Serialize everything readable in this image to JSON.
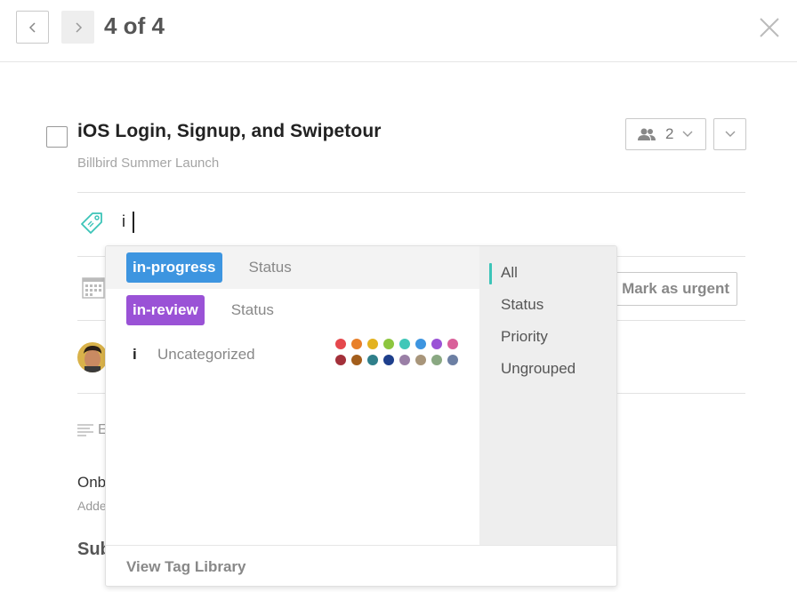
{
  "nav": {
    "prev_icon": "chevron-left-icon",
    "next_icon": "chevron-right-icon",
    "counter": "4 of 4",
    "close_icon": "close-icon"
  },
  "task": {
    "title": "iOS Login, Signup, and Swipetour",
    "project": "Billbird Summer Launch",
    "members_count": "2"
  },
  "tag_field": {
    "value": "i"
  },
  "actions": {
    "urgent_label": "Mark as urgent"
  },
  "background": {
    "description_fragment": "E",
    "onb": "Onb",
    "adde": "Adde",
    "sub": "Sub"
  },
  "dropdown": {
    "suggestions": [
      {
        "tag": "in-progress",
        "group": "Status",
        "color": "#3d95e0"
      },
      {
        "tag": "in-review",
        "group": "Status",
        "color": "#9a52d6"
      }
    ],
    "new_tag": {
      "tag": "i",
      "group": "Uncategorized"
    },
    "swatches": [
      "#e5484d",
      "#e8802a",
      "#e3b21f",
      "#8dc63f",
      "#40c7b8",
      "#3d95e0",
      "#9a52d6",
      "#d9609a",
      "#a3303a",
      "#a35e1c",
      "#2f7f8a",
      "#1e3f8c",
      "#9a7fa6",
      "#a8957a",
      "#8aa882",
      "#6c7fa3"
    ],
    "filters": [
      "All",
      "Status",
      "Priority",
      "Ungrouped"
    ],
    "footer": "View Tag Library"
  }
}
